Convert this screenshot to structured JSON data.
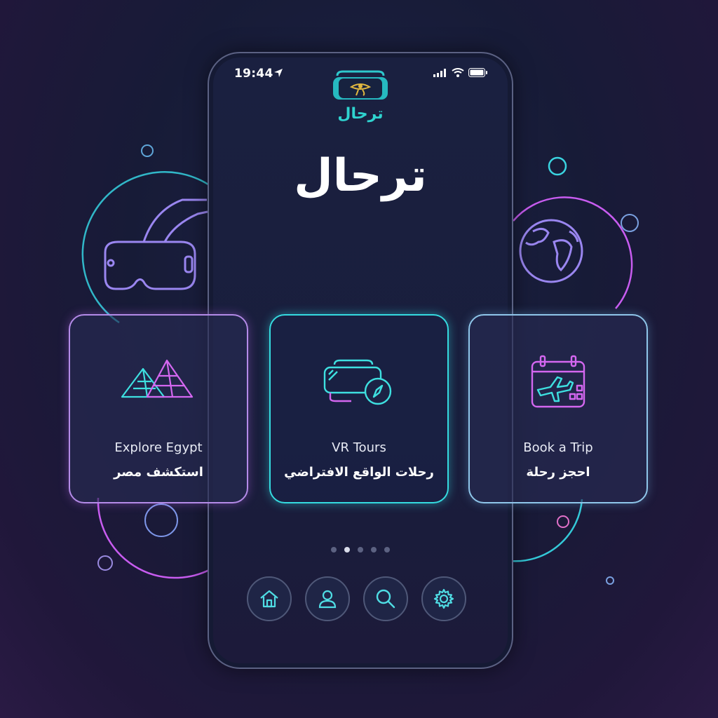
{
  "status": {
    "time": "19:44",
    "location_icon": "location-arrow-icon",
    "signal_icon": "signal-icon",
    "wifi_icon": "wifi-icon",
    "battery_icon": "battery-icon"
  },
  "app": {
    "logo_text": "ترحال",
    "title": "ترحال",
    "logo_icon": "vr-headset-eye-of-horus-icon"
  },
  "cards": [
    {
      "icon": "pyramids-icon",
      "label_en": "Explore Egypt",
      "label_ar": "استكشف مصر"
    },
    {
      "icon": "vr-compass-icon",
      "label_en": "VR Tours",
      "label_ar": "رحلات الواقع الافتراضي"
    },
    {
      "icon": "calendar-plane-icon",
      "label_en": "Book a Trip",
      "label_ar": "احجز  رحلة"
    }
  ],
  "pager": {
    "count": 5,
    "active": 1
  },
  "nav": [
    {
      "icon": "home-icon"
    },
    {
      "icon": "user-icon"
    },
    {
      "icon": "search-icon"
    },
    {
      "icon": "settings-gear-icon"
    }
  ],
  "colors": {
    "cyan": "#35dbe0",
    "magenta": "#c85cf0",
    "background": "#171b37"
  }
}
